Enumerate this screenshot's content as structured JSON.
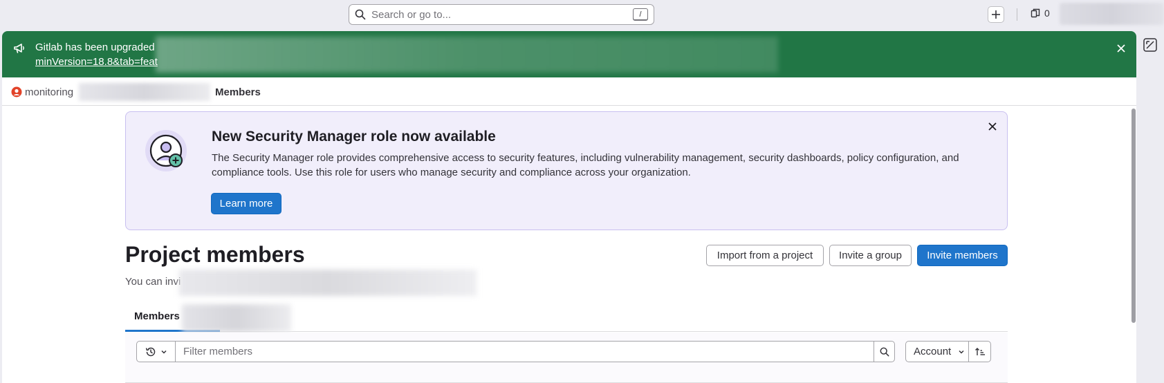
{
  "topbar": {
    "search_placeholder": "Search or go to...",
    "search_shortcut": "/",
    "merge_requests_count": "0"
  },
  "banner": {
    "text": "Gitlab has been upgraded",
    "link_text": "minVersion=18.8&tab=feat"
  },
  "breadcrumb": {
    "project": "monitoring",
    "current": "Members"
  },
  "callout": {
    "title": "New Security Manager role now available",
    "body": "The Security Manager role provides comprehensive access to security features, including vulnerability management, security dashboards, policy configuration, and compliance tools. Use this role for users who manage security and compliance across your organization.",
    "button_label": "Learn more"
  },
  "page": {
    "title": "Project members",
    "subtitle": "You can invi",
    "actions": {
      "import_label": "Import from a project",
      "invite_group_label": "Invite a group",
      "invite_members_label": "Invite members"
    }
  },
  "tabs": {
    "members_label": "Members"
  },
  "filter": {
    "placeholder": "Filter members",
    "sort_label": "Account"
  },
  "colors": {
    "banner_green": "#217645",
    "primary_blue": "#1f75cb",
    "callout_bg": "#f1eefb"
  }
}
